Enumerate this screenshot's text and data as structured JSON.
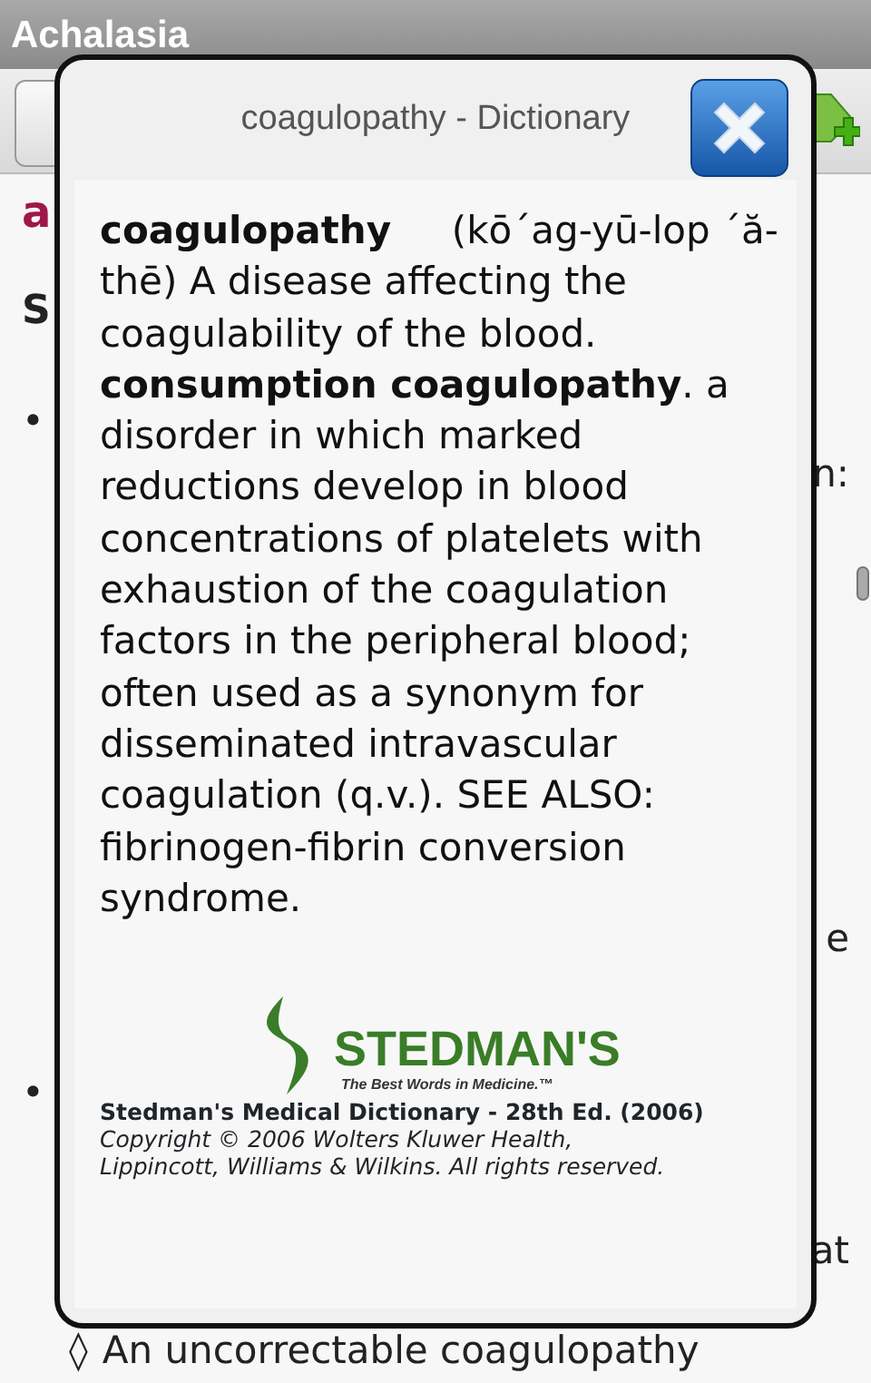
{
  "window": {
    "title": "Achalasia"
  },
  "page": {
    "heading_fragment": "a",
    "section_fragment": "S",
    "lines": [
      {
        "kind": "bullet",
        "marker": "•"
      },
      {
        "kind": "plain",
        "right": "n:"
      },
      {
        "kind": "plain",
        "right": "e"
      },
      {
        "kind": "bullet",
        "marker": "•"
      },
      {
        "kind": "plain",
        "right": "at"
      },
      {
        "kind": "sub",
        "marker": "◊",
        "text": "An uncorrectable coagulopathy"
      }
    ]
  },
  "dialog": {
    "title": "coagulopathy - Dictionary",
    "definition": "**coagulopathy**     (kō´ag-yū-lop ´ă-thē) A disease affecting the coagulability of the blood. **consumption coagulopathy**. a disorder in which marked reductions develop in blood concentrations of platelets with exhaustion of the coagulation factors in the peripheral blood; often used as a synonym for disseminated intravascular coagulation (q.v.). SEE ALSO: fibrinogen-fibrin conversion syndrome.",
    "logo": {
      "name": "STEDMAN'S",
      "tagline": "The Best Words in Medicine.™"
    },
    "source": "Stedman's Medical Dictionary - 28th Ed. (2006)",
    "copyright": "Copyright © 2006 Wolters Kluwer Health, Lippincott, Williams & Wilkins. All rights reserved."
  }
}
